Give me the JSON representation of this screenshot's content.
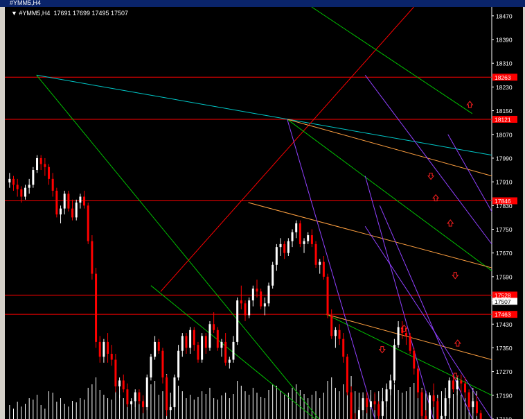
{
  "window": {
    "title": "#YMM5,H4"
  },
  "chart_header": {
    "symbol": "#YMM5,H4",
    "ohlc": "17691 17699 17495 17507"
  },
  "chart_data": {
    "type": "candlestick",
    "ylim": [
      17110,
      18500
    ],
    "y_ticks": [
      18470,
      18390,
      18310,
      18230,
      18150,
      18070,
      17990,
      17910,
      17830,
      17750,
      17670,
      17590,
      17510,
      17430,
      17350,
      17270,
      17190,
      17110
    ],
    "h_levels": [
      {
        "label": "18263",
        "value": 18263
      },
      {
        "label": "18121",
        "value": 18121
      },
      {
        "label": "17846",
        "value": 17846
      },
      {
        "label": "17528",
        "value": 17528
      },
      {
        "label": "17463",
        "value": 17463
      }
    ],
    "current_price": {
      "label": "17507",
      "value": 17507
    },
    "colors": {
      "up": "#ffffff",
      "down": "#ff0000",
      "level": "#ff0000",
      "grid_text": "#ffffff"
    },
    "candles": [
      [
        17908,
        17940,
        17890,
        17920
      ],
      [
        17920,
        17930,
        17880,
        17900
      ],
      [
        17900,
        17920,
        17860,
        17885
      ],
      [
        17885,
        17895,
        17840,
        17860
      ],
      [
        17860,
        17900,
        17850,
        17890
      ],
      [
        17890,
        17920,
        17870,
        17900
      ],
      [
        17900,
        17960,
        17890,
        17950
      ],
      [
        17950,
        18000,
        17940,
        17990
      ],
      [
        17990,
        18000,
        17950,
        17970
      ],
      [
        17970,
        17990,
        17930,
        17960
      ],
      [
        17960,
        17970,
        17900,
        17920
      ],
      [
        17920,
        17940,
        17860,
        17880
      ],
      [
        17880,
        17890,
        17790,
        17800
      ],
      [
        17800,
        17830,
        17770,
        17820
      ],
      [
        17820,
        17880,
        17800,
        17870
      ],
      [
        17870,
        17880,
        17810,
        17820
      ],
      [
        17820,
        17850,
        17780,
        17790
      ],
      [
        17790,
        17850,
        17780,
        17840
      ],
      [
        17840,
        17870,
        17820,
        17860
      ],
      [
        17860,
        17880,
        17820,
        17830
      ],
      [
        17830,
        17840,
        17700,
        17710
      ],
      [
        17710,
        17730,
        17580,
        17600
      ],
      [
        17600,
        17620,
        17350,
        17370
      ],
      [
        17370,
        17390,
        17300,
        17320
      ],
      [
        17320,
        17380,
        17300,
        17370
      ],
      [
        17370,
        17400,
        17300,
        17330
      ],
      [
        17330,
        17360,
        17290,
        17310
      ],
      [
        17310,
        17330,
        17200,
        17220
      ],
      [
        17220,
        17250,
        17180,
        17240
      ],
      [
        17240,
        17260,
        17200,
        17210
      ],
      [
        17210,
        17230,
        17150,
        17160
      ],
      [
        17160,
        17180,
        17140,
        17170
      ],
      [
        17170,
        17210,
        17150,
        17200
      ],
      [
        17200,
        17210,
        17160,
        17170
      ],
      [
        17170,
        17190,
        17130,
        17150
      ],
      [
        17150,
        17260,
        17140,
        17250
      ],
      [
        17250,
        17330,
        17240,
        17320
      ],
      [
        17320,
        17390,
        17310,
        17370
      ],
      [
        17370,
        17380,
        17330,
        17340
      ],
      [
        17340,
        17350,
        17230,
        17250
      ],
      [
        17250,
        17260,
        17120,
        17140
      ],
      [
        17140,
        17160,
        17110,
        17150
      ],
      [
        17150,
        17260,
        17140,
        17250
      ],
      [
        17250,
        17360,
        17240,
        17340
      ],
      [
        17340,
        17400,
        17320,
        17390
      ],
      [
        17390,
        17400,
        17330,
        17350
      ],
      [
        17350,
        17420,
        17330,
        17410
      ],
      [
        17410,
        17420,
        17340,
        17360
      ],
      [
        17360,
        17370,
        17300,
        17310
      ],
      [
        17310,
        17400,
        17300,
        17390
      ],
      [
        17390,
        17400,
        17330,
        17350
      ],
      [
        17350,
        17440,
        17340,
        17430
      ],
      [
        17430,
        17470,
        17400,
        17410
      ],
      [
        17410,
        17420,
        17340,
        17350
      ],
      [
        17350,
        17380,
        17320,
        17370
      ],
      [
        17370,
        17400,
        17290,
        17300
      ],
      [
        17300,
        17320,
        17280,
        17310
      ],
      [
        17310,
        17390,
        17300,
        17370
      ],
      [
        17370,
        17520,
        17360,
        17510
      ],
      [
        17510,
        17560,
        17480,
        17500
      ],
      [
        17500,
        17510,
        17440,
        17460
      ],
      [
        17460,
        17520,
        17450,
        17510
      ],
      [
        17510,
        17560,
        17490,
        17550
      ],
      [
        17550,
        17580,
        17520,
        17540
      ],
      [
        17540,
        17550,
        17480,
        17490
      ],
      [
        17490,
        17520,
        17460,
        17500
      ],
      [
        17500,
        17570,
        17490,
        17560
      ],
      [
        17560,
        17640,
        17550,
        17630
      ],
      [
        17630,
        17700,
        17610,
        17690
      ],
      [
        17690,
        17720,
        17660,
        17700
      ],
      [
        17700,
        17710,
        17650,
        17670
      ],
      [
        17670,
        17720,
        17660,
        17710
      ],
      [
        17710,
        17750,
        17690,
        17740
      ],
      [
        17740,
        17780,
        17720,
        17770
      ],
      [
        17770,
        17780,
        17690,
        17700
      ],
      [
        17700,
        17720,
        17670,
        17710
      ],
      [
        17710,
        17740,
        17700,
        17730
      ],
      [
        17730,
        17750,
        17690,
        17700
      ],
      [
        17700,
        17710,
        17620,
        17630
      ],
      [
        17630,
        17650,
        17600,
        17640
      ],
      [
        17640,
        17660,
        17580,
        17590
      ],
      [
        17590,
        17600,
        17450,
        17460
      ],
      [
        17460,
        17480,
        17380,
        17390
      ],
      [
        17390,
        17420,
        17350,
        17410
      ],
      [
        17410,
        17430,
        17360,
        17380
      ],
      [
        17380,
        17400,
        17300,
        17320
      ],
      [
        17320,
        17330,
        17190,
        17200
      ],
      [
        17200,
        17220,
        17100,
        17110
      ],
      [
        17110,
        17130,
        17080,
        17090
      ],
      [
        17090,
        17150,
        17080,
        17140
      ],
      [
        17140,
        17200,
        17120,
        17180
      ],
      [
        17180,
        17200,
        17130,
        17150
      ],
      [
        17150,
        17190,
        17140,
        17170
      ],
      [
        17170,
        17200,
        17140,
        17160
      ],
      [
        17160,
        17170,
        17100,
        17120
      ],
      [
        17120,
        17180,
        17110,
        17170
      ],
      [
        17170,
        17230,
        17150,
        17210
      ],
      [
        17210,
        17260,
        17190,
        17240
      ],
      [
        17240,
        17380,
        17230,
        17360
      ],
      [
        17360,
        17440,
        17350,
        17420
      ],
      [
        17420,
        17440,
        17380,
        17400
      ],
      [
        17400,
        17420,
        17360,
        17390
      ],
      [
        17390,
        17400,
        17330,
        17340
      ],
      [
        17340,
        17350,
        17260,
        17280
      ],
      [
        17280,
        17290,
        17180,
        17200
      ],
      [
        17200,
        17210,
        17100,
        17120
      ],
      [
        17120,
        17140,
        17080,
        17100
      ],
      [
        17100,
        17200,
        17090,
        17190
      ],
      [
        17190,
        17230,
        17150,
        17170
      ],
      [
        17170,
        17180,
        17100,
        17110
      ],
      [
        17110,
        17130,
        17090,
        17120
      ],
      [
        17120,
        17190,
        17110,
        17180
      ],
      [
        17180,
        17250,
        17160,
        17240
      ],
      [
        17240,
        17260,
        17200,
        17210
      ],
      [
        17210,
        17250,
        17190,
        17240
      ],
      [
        17240,
        17260,
        17200,
        17230
      ],
      [
        17230,
        17250,
        17180,
        17200
      ],
      [
        17200,
        17210,
        17140,
        17150
      ],
      [
        17150,
        17180,
        17130,
        17170
      ],
      [
        17170,
        17190,
        17120,
        17130
      ],
      [
        17130,
        17140,
        17060,
        17080
      ],
      [
        17080,
        17100,
        17040,
        17060
      ]
    ],
    "volumes": [
      20,
      15,
      25,
      18,
      22,
      30,
      28,
      35,
      20,
      15,
      40,
      38,
      25,
      30,
      22,
      18,
      26,
      24,
      30,
      28,
      45,
      50,
      60,
      42,
      35,
      30,
      28,
      40,
      35,
      30,
      38,
      26,
      30,
      24,
      28,
      45,
      50,
      55,
      35,
      40,
      65,
      38,
      42,
      48,
      40,
      30,
      35,
      28,
      32,
      40,
      36,
      45,
      30,
      28,
      34,
      38,
      30,
      36,
      55,
      48,
      40,
      35,
      45,
      38,
      32,
      30,
      42,
      50,
      48,
      40,
      35,
      38,
      45,
      50,
      42,
      36,
      30,
      35,
      40,
      30,
      38,
      55,
      60,
      45,
      40,
      50,
      58,
      62,
      40,
      38,
      35,
      30,
      42,
      36,
      40,
      45,
      48,
      55,
      50,
      42,
      38,
      40,
      46,
      52,
      58,
      45,
      40,
      38,
      42,
      35,
      40,
      45,
      38,
      36,
      40,
      35,
      42,
      38,
      45,
      40
    ],
    "trendlines": [
      {
        "color": "#00c8c8",
        "x1": 0.065,
        "v1": 18270,
        "x2": 1.0,
        "v2": 18000
      },
      {
        "color": "#00c000",
        "x1": 0.065,
        "v1": 18270,
        "x2": 0.66,
        "v2": 17080
      },
      {
        "color": "#00c000",
        "x1": 0.3,
        "v1": 17560,
        "x2": 0.66,
        "v2": 17080
      },
      {
        "color": "#ff0000",
        "x1": 0.32,
        "v1": 17540,
        "x2": 0.84,
        "v2": 18500
      },
      {
        "color": "#00c000",
        "x1": 0.63,
        "v1": 18500,
        "x2": 0.96,
        "v2": 18140
      },
      {
        "color": "#00c000",
        "x1": 0.58,
        "v1": 18121,
        "x2": 1.0,
        "v2": 17610
      },
      {
        "color": "#ffa040",
        "x1": 0.58,
        "v1": 18121,
        "x2": 1.0,
        "v2": 17930
      },
      {
        "color": "#ffa040",
        "x1": 0.5,
        "v1": 17840,
        "x2": 1.0,
        "v2": 17620
      },
      {
        "color": "#ffa040",
        "x1": 0.66,
        "v1": 17463,
        "x2": 1.0,
        "v2": 17310
      },
      {
        "color": "#00c000",
        "x1": 0.66,
        "v1": 17463,
        "x2": 1.0,
        "v2": 17190
      },
      {
        "color": "#9040ff",
        "x1": 0.58,
        "v1": 18121,
        "x2": 0.76,
        "v2": 17110
      },
      {
        "color": "#9040ff",
        "x1": 0.74,
        "v1": 18270,
        "x2": 1.0,
        "v2": 17700
      },
      {
        "color": "#9040ff",
        "x1": 0.74,
        "v1": 17930,
        "x2": 0.88,
        "v2": 17110
      },
      {
        "color": "#9040ff",
        "x1": 0.77,
        "v1": 17830,
        "x2": 0.96,
        "v2": 17110
      },
      {
        "color": "#9040ff",
        "x1": 0.91,
        "v1": 18070,
        "x2": 1.0,
        "v2": 17810
      },
      {
        "color": "#9040ff",
        "x1": 0.74,
        "v1": 17760,
        "x2": 1.0,
        "v2": 17110
      }
    ],
    "arrows": [
      {
        "dir": "up",
        "x": 0.955,
        "v": 18170
      },
      {
        "dir": "down",
        "x": 0.875,
        "v": 17930
      },
      {
        "dir": "up",
        "x": 0.885,
        "v": 17855
      },
      {
        "dir": "up",
        "x": 0.915,
        "v": 17770
      },
      {
        "dir": "down",
        "x": 0.925,
        "v": 17595
      },
      {
        "dir": "up",
        "x": 0.82,
        "v": 17415
      },
      {
        "dir": "down",
        "x": 0.775,
        "v": 17345
      },
      {
        "dir": "up",
        "x": 0.93,
        "v": 17365
      },
      {
        "dir": "down",
        "x": 0.925,
        "v": 17255
      }
    ]
  }
}
